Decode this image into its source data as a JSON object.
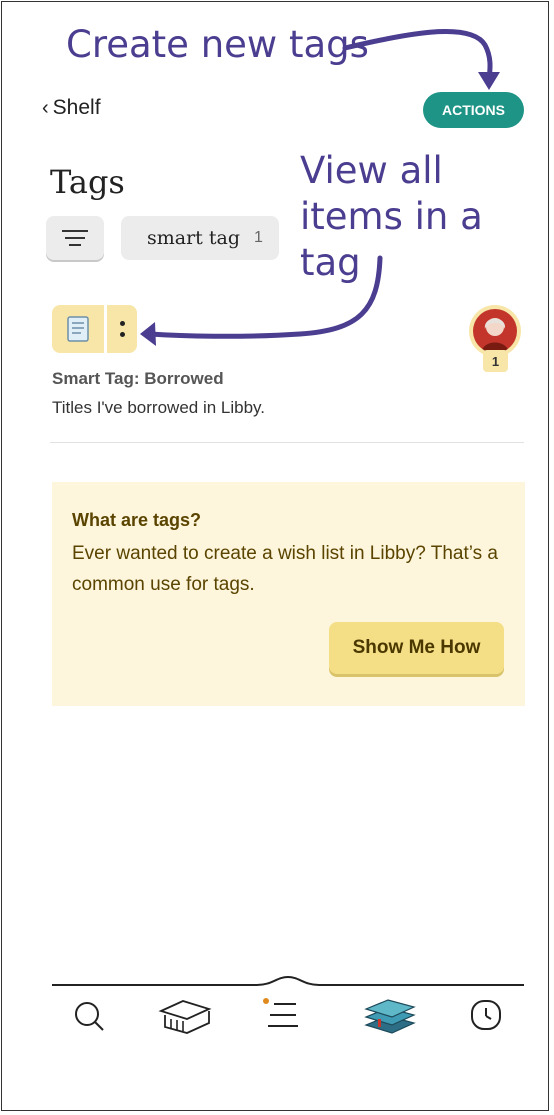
{
  "annotations": {
    "create": "Create new tags",
    "view": "View all items in a tag"
  },
  "header": {
    "back_label": "Shelf",
    "actions_label": "ACTIONS"
  },
  "page_title": "Tags",
  "filter": {
    "chip_label": "smart tag",
    "chip_count": "1"
  },
  "tag": {
    "name": "Smart Tag: Borrowed",
    "description": "Titles I've borrowed in Libby.",
    "avatar_badge": "1"
  },
  "info_card": {
    "title": "What are tags?",
    "body": "Ever wanted to create a wish list in Libby? That’s a common use for tags.",
    "button_label": "Show Me How"
  },
  "bottom_nav": [
    "search-icon",
    "library-icon",
    "menu-icon",
    "shelf-icon",
    "timeline-icon"
  ],
  "colors": {
    "accent": "#1e9486",
    "annotation": "#4b3d8f",
    "tag_yellow": "#f7e6a8",
    "card_bg": "#fdf6dc"
  }
}
